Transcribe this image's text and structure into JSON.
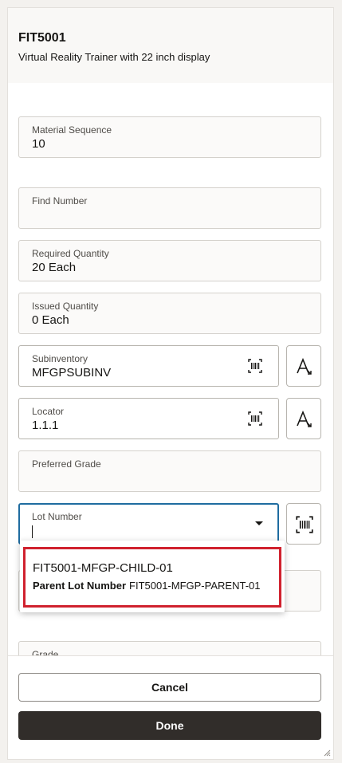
{
  "header": {
    "title": "FIT5001",
    "subtitle": "Virtual Reality Trainer with 22 inch display"
  },
  "fields": {
    "material_sequence": {
      "label": "Material Sequence",
      "value": "10"
    },
    "find_number": {
      "label": "Find Number",
      "value": ""
    },
    "required_quantity": {
      "label": "Required Quantity",
      "value": "20 Each"
    },
    "issued_quantity": {
      "label": "Issued Quantity",
      "value": "0 Each"
    },
    "subinventory": {
      "label": "Subinventory",
      "value": "MFGPSUBINV"
    },
    "locator": {
      "label": "Locator",
      "value": "1.1.1"
    },
    "preferred_grade": {
      "label": "Preferred Grade",
      "value": ""
    },
    "lot_number": {
      "label": "Lot Number",
      "value": ""
    },
    "grade": {
      "label": "Grade",
      "value": ""
    }
  },
  "lot_dropdown": {
    "items": [
      {
        "lot": "FIT5001-MFGP-CHILD-01",
        "parent_label": "Parent Lot Number",
        "parent_value": "FIT5001-MFGP-PARENT-01"
      }
    ]
  },
  "footer": {
    "cancel_label": "Cancel",
    "done_label": "Done"
  },
  "icons": {
    "scan": "barcode-scan-icon",
    "font_action": "text-action-icon",
    "dropdown": "chevron-down-icon"
  },
  "colors": {
    "focus_border": "#1f6ca0",
    "highlight_border": "#d0212e",
    "primary_button": "#312d2a"
  }
}
